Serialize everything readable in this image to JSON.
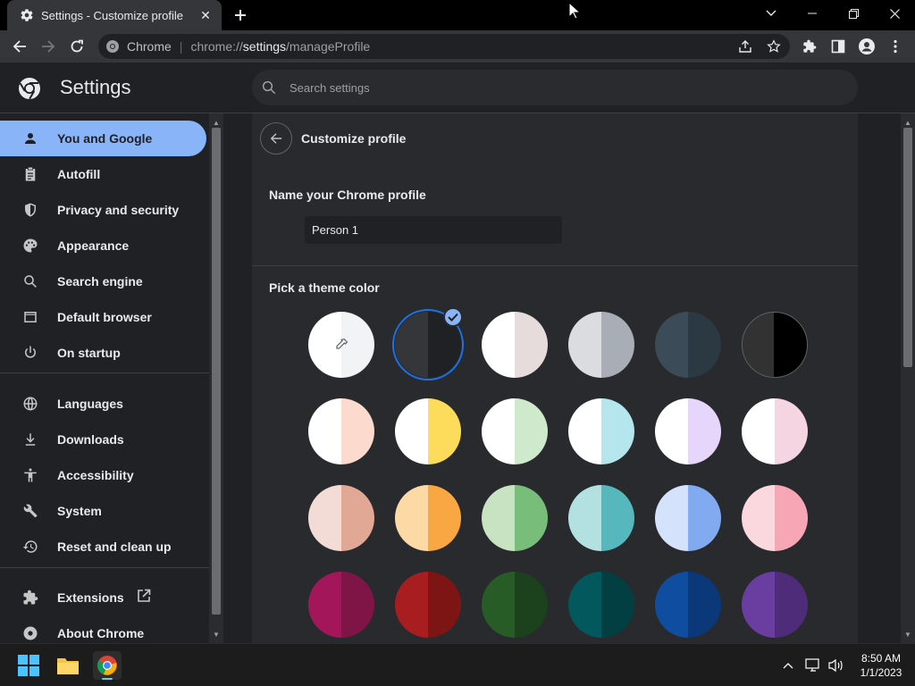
{
  "window": {
    "tab_title": "Settings - Customize profile",
    "close_tab_glyph": "✕"
  },
  "omnibox": {
    "site_chip": "Chrome",
    "url_scheme": "chrome://",
    "url_host": "settings",
    "url_path": "/manageProfile"
  },
  "header": {
    "title": "Settings",
    "search_placeholder": "Search settings"
  },
  "sidebar": {
    "items": [
      {
        "label": "You and Google",
        "icon": "person-icon",
        "active": true
      },
      {
        "label": "Autofill",
        "icon": "clipboard-icon"
      },
      {
        "label": "Privacy and security",
        "icon": "shield-icon"
      },
      {
        "label": "Appearance",
        "icon": "palette-icon"
      },
      {
        "label": "Search engine",
        "icon": "search-icon"
      },
      {
        "label": "Default browser",
        "icon": "browser-icon"
      },
      {
        "label": "On startup",
        "icon": "power-icon"
      },
      {
        "label": "Languages",
        "icon": "globe-icon"
      },
      {
        "label": "Downloads",
        "icon": "download-icon"
      },
      {
        "label": "Accessibility",
        "icon": "accessibility-icon"
      },
      {
        "label": "System",
        "icon": "wrench-icon"
      },
      {
        "label": "Reset and clean up",
        "icon": "history-icon"
      },
      {
        "label": "Extensions",
        "icon": "puzzle-icon"
      },
      {
        "label": "About Chrome",
        "icon": "chrome-icon"
      }
    ]
  },
  "main": {
    "title": "Customize profile",
    "name_label": "Name your Chrome profile",
    "name_value": "Person 1",
    "theme_label": "Pick a theme color",
    "selected_theme_index": 1,
    "themes": [
      {
        "left": "#ffffff",
        "right": "#f1f3f4",
        "custom": true
      },
      {
        "left": "#35363a",
        "right": "#202124"
      },
      {
        "left": "#ffffff",
        "right": "#e6dcdc"
      },
      {
        "left": "#dadce0",
        "right": "#a9adb5"
      },
      {
        "left": "#3c4b58",
        "right": "#2b3942"
      },
      {
        "left": "#323232",
        "right": "#000000"
      },
      {
        "left": "#ffffff",
        "right": "#fcdacd"
      },
      {
        "left": "#ffffff",
        "right": "#fddc5c"
      },
      {
        "left": "#ffffff",
        "right": "#cfe9cc"
      },
      {
        "left": "#ffffff",
        "right": "#b5e6ee"
      },
      {
        "left": "#ffffff",
        "right": "#e6d6fb"
      },
      {
        "left": "#ffffff",
        "right": "#f5d5e1"
      },
      {
        "left": "#f4dcd6",
        "right": "#e2a896"
      },
      {
        "left": "#fdd9a6",
        "right": "#f8a743"
      },
      {
        "left": "#c7e3c2",
        "right": "#78bd7a"
      },
      {
        "left": "#b3e1e2",
        "right": "#56b8bc"
      },
      {
        "left": "#d4e2fb",
        "right": "#82aaf0"
      },
      {
        "left": "#fbd8de",
        "right": "#f7a6b5"
      },
      {
        "left": "#a3175a",
        "right": "#7f1546"
      },
      {
        "left": "#a81d1f",
        "right": "#7d1515"
      },
      {
        "left": "#275c27",
        "right": "#1c421d"
      },
      {
        "left": "#02585c",
        "right": "#013f42"
      },
      {
        "left": "#0e4da0",
        "right": "#0b3878"
      },
      {
        "left": "#6a3ea1",
        "right": "#4e2c7a"
      }
    ]
  },
  "taskbar": {
    "time": "8:50 AM",
    "date": "1/1/2023"
  }
}
